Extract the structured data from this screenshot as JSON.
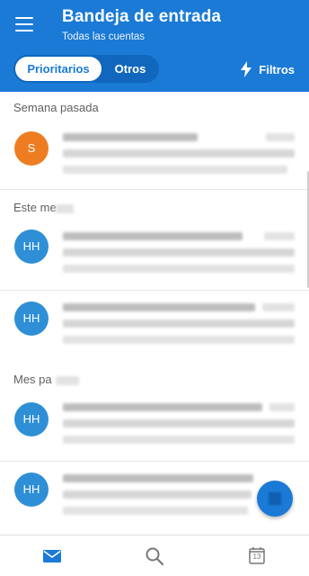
{
  "header": {
    "title": "Bandeja de entrada",
    "subtitle": "Todas las cuentas",
    "menu_icon": "hamburger-menu-icon",
    "tabs": [
      {
        "label": "Prioritarios",
        "selected": true
      },
      {
        "label": "Otros",
        "selected": false
      }
    ],
    "filters_label": "Filtros",
    "filters_icon": "lightning-icon"
  },
  "sections": [
    {
      "label": "Semana pasada"
    },
    {
      "label": "Este me"
    },
    {
      "label": "Mes pa"
    }
  ],
  "messages": [
    {
      "avatar_initials": "S",
      "avatar_color": "#ee7d22"
    },
    {
      "avatar_initials": "HH",
      "avatar_color": "#2f8fd6"
    },
    {
      "avatar_initials": "HH",
      "avatar_color": "#2f8fd6"
    },
    {
      "avatar_initials": "HH",
      "avatar_color": "#2f8fd6"
    },
    {
      "avatar_initials": "HH",
      "avatar_color": "#2f8fd6"
    }
  ],
  "bottom_nav": {
    "items": [
      {
        "icon": "mail-icon",
        "active": true
      },
      {
        "icon": "search-icon",
        "active": false
      },
      {
        "icon": "calendar-icon",
        "active": false,
        "label": "13"
      }
    ]
  },
  "colors": {
    "primary": "#1a7ad6",
    "primary_dark": "#1167bd"
  }
}
